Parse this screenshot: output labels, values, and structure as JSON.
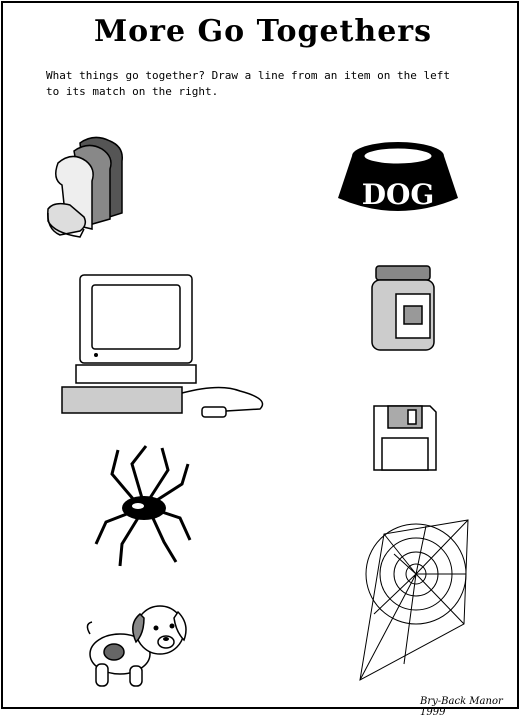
{
  "title": "More Go Togethers",
  "instructions": "What things go together? Draw a line from an item on the left to its match on the right.",
  "left_items": [
    "bread-icon",
    "computer-icon",
    "spider-icon",
    "puppy-icon"
  ],
  "right_items": [
    "dog-bowl-icon",
    "jar-icon",
    "floppy-disk-icon",
    "spider-web-icon"
  ],
  "bowl_label": "DOG",
  "credit": "Bry-Back Manor 1999"
}
